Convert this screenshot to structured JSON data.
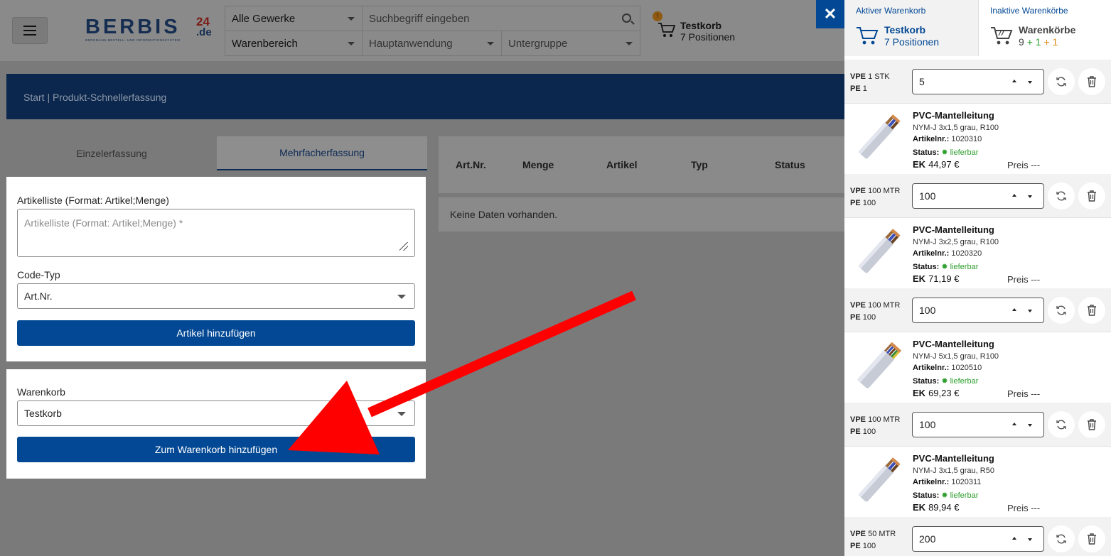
{
  "header": {
    "logo": {
      "word": "BERBIS",
      "sup": "24",
      "tld": ".de",
      "tagline": "BERGMANN BESTELL- UND INFORMATIONSSYSTEM"
    },
    "search": {
      "trade": "Alle Gewerke",
      "placeholder": "Suchbegriff eingeben",
      "area": "Warenbereich",
      "main_use": "Hauptanwendung",
      "subgroup": "Untergruppe"
    },
    "cart": {
      "badge": "!",
      "name": "Testkorb",
      "positions": "7 Positionen"
    }
  },
  "breadcrumb": "Start | Produkt-Schnellerfassung",
  "tabs": {
    "single": "Einzelerfassung",
    "multi": "Mehrfacherfassung"
  },
  "form": {
    "list_label": "Artikelliste (Format: Artikel;Menge)",
    "list_placeholder": "Artikelliste (Format: Artikel;Menge) *",
    "code_label": "Code-Typ",
    "code_value": "Art.Nr.",
    "add_button": "Artikel hinzufügen",
    "cart_label": "Warenkorb",
    "cart_value": "Testkorb",
    "cart_button": "Zum Warenkorb hinzufügen"
  },
  "table": {
    "columns": [
      "Art.Nr.",
      "Menge",
      "Artikel",
      "Typ",
      "Status"
    ],
    "empty": "Keine Daten vorhanden."
  },
  "panel": {
    "active_tab": {
      "title": "Aktiver Warenkorb",
      "name": "Testkorb",
      "positions": "7 Positionen"
    },
    "inactive_tab": {
      "title": "Inaktive Warenkörbe",
      "name": "Warenkörbe",
      "count": "9",
      "plus_green": "+ 1",
      "plus_orange": "+ 1"
    },
    "close": "✕",
    "qty_rows": [
      {
        "vpe_label": "VPE",
        "vpe": "1 STK",
        "pe_label": "PE",
        "pe": "1",
        "qty": "5"
      },
      {
        "vpe_label": "VPE",
        "vpe": "100 MTR",
        "pe_label": "PE",
        "pe": "100",
        "qty": "100"
      },
      {
        "vpe_label": "VPE",
        "vpe": "100 MTR",
        "pe_label": "PE",
        "pe": "100",
        "qty": "100"
      },
      {
        "vpe_label": "VPE",
        "vpe": "100 MTR",
        "pe_label": "PE",
        "pe": "100",
        "qty": "100"
      },
      {
        "vpe_label": "VPE",
        "vpe": "50 MTR",
        "pe_label": "PE",
        "pe": "100",
        "qty": "200"
      }
    ],
    "products": [
      {
        "name": "PVC-Mantelleitung",
        "desc": "NYM-J 3x1,5 grau, R100",
        "art_label": "Artikelnr.:",
        "art": "1020310",
        "status_label": "Status:",
        "status": "lieferbar",
        "ek_label": "EK",
        "ek": "44,97 €",
        "price": "Preis ---"
      },
      {
        "name": "PVC-Mantelleitung",
        "desc": "NYM-J 3x2,5 grau, R100",
        "art_label": "Artikelnr.:",
        "art": "1020320",
        "status_label": "Status:",
        "status": "lieferbar",
        "ek_label": "EK",
        "ek": "71,19 €",
        "price": "Preis ---"
      },
      {
        "name": "PVC-Mantelleitung",
        "desc": "NYM-J 5x1,5 grau, R100",
        "art_label": "Artikelnr.:",
        "art": "1020510",
        "status_label": "Status:",
        "status": "lieferbar",
        "ek_label": "EK",
        "ek": "69,23 €",
        "price": "Preis ---"
      },
      {
        "name": "PVC-Mantelleitung",
        "desc": "NYM-J 3x1,5 grau, R50",
        "art_label": "Artikelnr.:",
        "art": "1020311",
        "status_label": "Status:",
        "status": "lieferbar",
        "ek_label": "EK",
        "ek": "89,94 €",
        "price": "Preis ---"
      }
    ]
  },
  "colors": {
    "brand_blue": "#034894",
    "navy": "#0b274d",
    "arrow": "#ff0000",
    "ok_green": "#2e9e2e"
  }
}
